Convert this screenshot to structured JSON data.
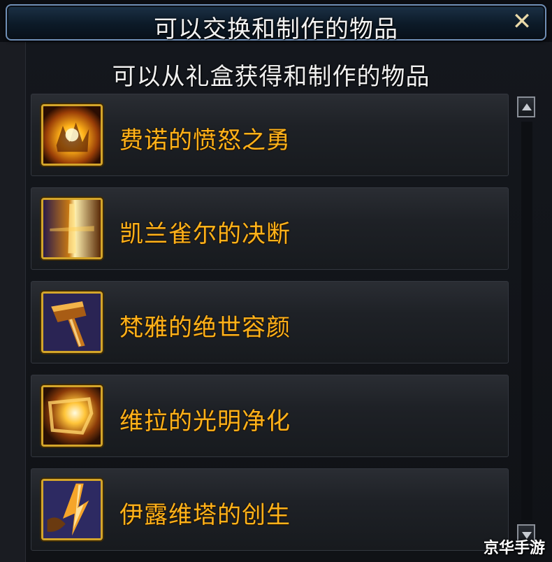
{
  "window": {
    "title": "可以交换和制作的物品",
    "close_icon": "close-icon"
  },
  "subtitle": "可以从礼盒获得和制作的物品",
  "items": [
    {
      "name": "费诺的愤怒之勇",
      "icon": "fiery-fist-icon"
    },
    {
      "name": "凯兰雀尔的决断",
      "icon": "light-blade-icon"
    },
    {
      "name": "梵雅的绝世容颜",
      "icon": "hammer-icon"
    },
    {
      "name": "维拉的光明净化",
      "icon": "light-gauntlet-icon"
    },
    {
      "name": "伊露维塔的创生",
      "icon": "creation-hand-icon"
    }
  ],
  "watermark": "京华手游",
  "colors": {
    "item_text": "#ffb21a",
    "icon_frame": "#d4a52a",
    "title_border": "#6f8fb6"
  }
}
